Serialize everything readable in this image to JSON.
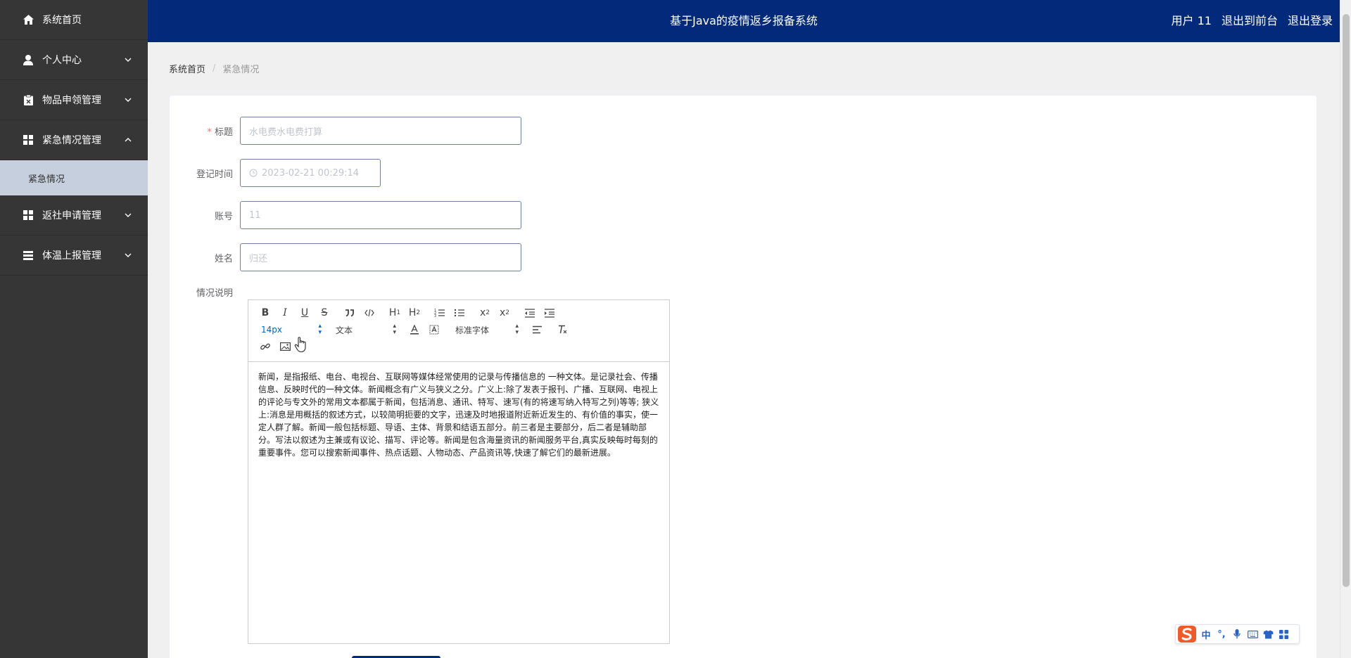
{
  "sidebar": {
    "items": [
      {
        "label": "系统首页",
        "icon": "home-icon",
        "expandable": false
      },
      {
        "label": "个人中心",
        "icon": "user-icon",
        "expandable": true
      },
      {
        "label": "物品申领管理",
        "icon": "clipboard-icon",
        "expandable": true
      },
      {
        "label": "紧急情况管理",
        "icon": "grid-icon",
        "expandable": true,
        "expanded": true
      },
      {
        "label": "返社申请管理",
        "icon": "grid-icon",
        "expandable": true
      },
      {
        "label": "体温上报管理",
        "icon": "list-icon",
        "expandable": true
      }
    ],
    "submenu": {
      "label": "紧急情况"
    }
  },
  "header": {
    "title": "基于Java的疫情返乡报备系统",
    "user": "用户 11",
    "to_front": "退出到前台",
    "logout": "退出登录"
  },
  "breadcrumb": {
    "home": "系统首页",
    "separator": "/",
    "current": "紧急情况"
  },
  "form": {
    "title": {
      "label": "标题",
      "placeholder": "水电费水电费打算"
    },
    "time": {
      "label": "登记时间",
      "value": "2023-02-21 00:29:14"
    },
    "account": {
      "label": "账号",
      "placeholder": "11"
    },
    "name": {
      "label": "姓名",
      "placeholder": "归还"
    },
    "desc": {
      "label": "情况说明"
    }
  },
  "editor": {
    "size_picker": "14px",
    "header_picker": "文本",
    "font_picker": "标准字体",
    "content": "新闻，是指报纸、电台、电视台、互联网等媒体经常使用的记录与传播信息的 一种文体。是记录社会、传播信息、反映时代的一种文体。新闻概念有广义与狭义之分。广义上:除了发表于报刊、广播、互联网、电视上的评论与专文外的常用文本都属于新闻，包括消息、通讯、特写、速写(有的将速写纳入特写之列)等等; 狭义上:消息是用概括的叙述方式，以较简明扼要的文字，迅速及时地报道附近新近发生的、有价值的事实，使一定人群了解。新闻一般包括标题、导语、主体、背景和结语五部分。前三者是主要部分，后二者是辅助部分。写法以叙述为主兼或有议论、描写、评论等。新闻是包含海量资讯的新闻服务平台,真实反映每时每刻的重要事件。您可以搜索新闻事件、热点话题、人物动态、产品资讯等,快速了解它们的最新进展。"
  },
  "ime": {
    "zh": "中",
    "punct": "°,"
  },
  "colors": {
    "header_bg": "#032a7a",
    "sidebar_bg": "#363636",
    "submenu_bg": "#c6cfdd",
    "required": "#f56c6c"
  }
}
